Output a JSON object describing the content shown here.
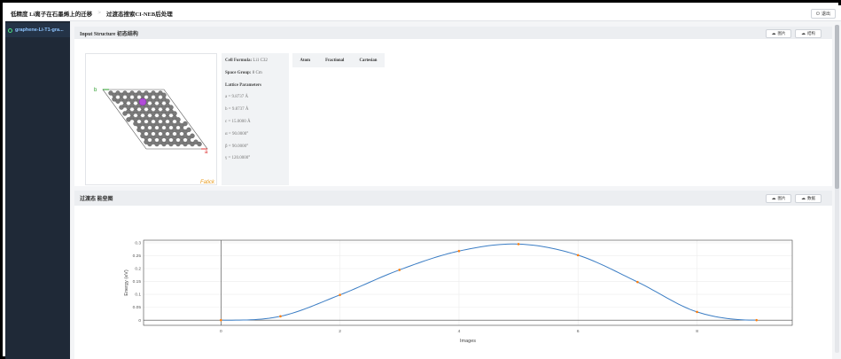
{
  "header": {
    "crumb1": "低精度 Li离子在石墨烯上的迁移",
    "sep": ">",
    "crumb2": "过渡态搜索CI-NEB后处理",
    "exit_label": "退出"
  },
  "sidebar": {
    "items": [
      {
        "label": "graphene-Li-T1-gra..."
      }
    ]
  },
  "structure_card": {
    "title": "Input Structure 初态结构",
    "btn_image": "图片",
    "btn_structure": "结构",
    "a_label": "a",
    "b_label": "b",
    "viewer_brand": "Fatick",
    "cell_formula_label": "Cell Formula:",
    "cell_formula": "Li1 C32",
    "space_group_label": "Space Group:",
    "space_group": "8 Cm",
    "lattice_title": "Lattice Parameters",
    "lattice": [
      "a = 9.8737 Å",
      "b = 9.8737 Å",
      "c = 15.0000 Å",
      "α = 90.0000°",
      "β = 90.0000°",
      "γ = 120.0000°"
    ],
    "atom_columns": [
      "Atom",
      "Fractional",
      "Cartesian"
    ]
  },
  "energy_card": {
    "title": "过渡态 能垒图",
    "btn_image": "图片",
    "btn_data": "数据"
  },
  "colors": {
    "sidebar": "#1f2937",
    "line": "#3b7dc4",
    "marker": "#ff7f0e",
    "carbon": "#7a7a7a",
    "lithium": "#b14cd9"
  },
  "chart_data": {
    "type": "line",
    "title": "",
    "xlabel": "Images",
    "ylabel": "Energy (eV)",
    "x": [
      0,
      1,
      2,
      3,
      4,
      5,
      6,
      7,
      8,
      9
    ],
    "y": [
      0.0,
      0.015,
      0.098,
      0.195,
      0.268,
      0.295,
      0.252,
      0.148,
      0.032,
      0.0
    ],
    "xlim": [
      -1.3,
      9.6
    ],
    "ylim": [
      -0.02,
      0.31
    ],
    "xticks": [
      0,
      2,
      4,
      6,
      8
    ],
    "yticks": [
      0,
      0.05,
      0.1,
      0.15,
      0.2,
      0.25,
      0.3
    ],
    "ytick_labels": [
      "0",
      "0.05",
      "0.1",
      "0.15",
      "0.2",
      "0.25",
      "0.3"
    ],
    "grid": true
  }
}
